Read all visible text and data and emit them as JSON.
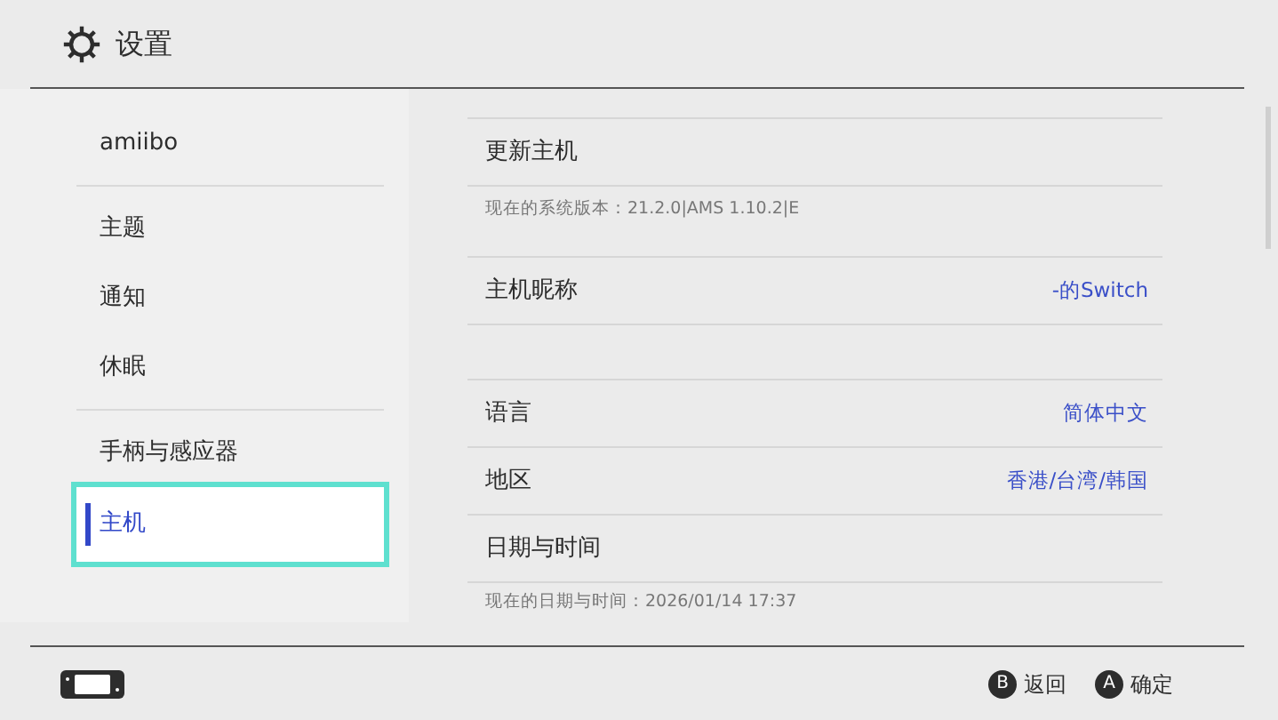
{
  "header": {
    "title": "设置"
  },
  "sidebar": {
    "groups": [
      [
        {
          "label": "amiibo",
          "selected": false
        }
      ],
      [
        {
          "label": "主题",
          "selected": false
        },
        {
          "label": "通知",
          "selected": false
        },
        {
          "label": "休眠",
          "selected": false
        }
      ],
      [
        {
          "label": "手柄与感应器",
          "selected": false
        },
        {
          "label": "主机",
          "selected": true
        }
      ]
    ]
  },
  "sections": [
    [
      {
        "label": "更新主机",
        "note": "现在的系统版本：21.2.0|AMS 1.10.2|E"
      },
      {
        "label": "主机昵称",
        "value": "-的Switch"
      }
    ],
    [
      {
        "label": "语言",
        "value": "简体中文"
      },
      {
        "label": "地区",
        "value": "香港/台湾/韩国"
      },
      {
        "label": "日期与时间",
        "note": "现在的日期与时间：2026/01/14 17:37"
      }
    ]
  ],
  "footer": {
    "buttons": [
      {
        "key": "B",
        "label": "返回"
      },
      {
        "key": "A",
        "label": "确定"
      }
    ]
  }
}
